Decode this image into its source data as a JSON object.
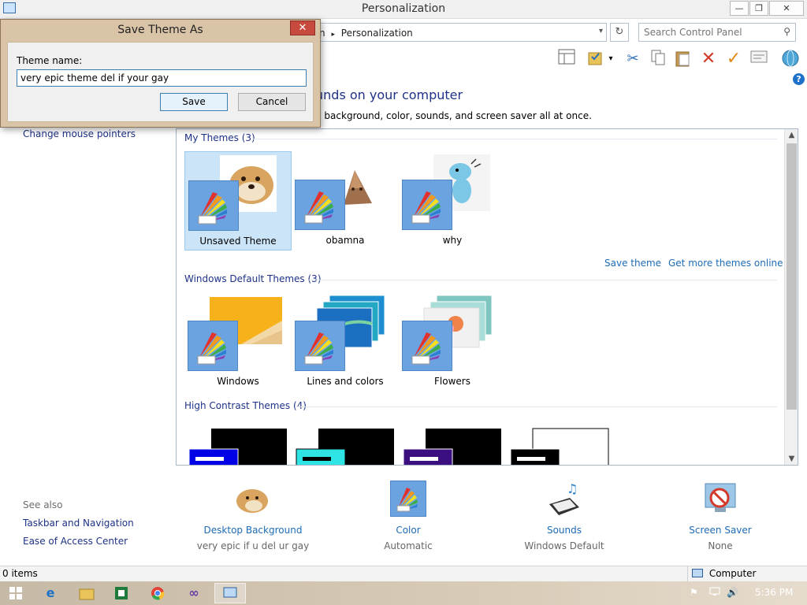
{
  "window": {
    "title": "Personalization",
    "minimize": "—",
    "restore": "❐",
    "close": "✕"
  },
  "address": {
    "breadcrumb_tail": "n",
    "separator": "▸",
    "current": "Personalization",
    "dropdown": "▾",
    "refresh": "↻",
    "search_placeholder": "Search Control Panel",
    "search_icon": "⚲"
  },
  "main": {
    "heading": "unds on your computer",
    "subtext": "p background, color, sounds, and screen saver all at once.",
    "help": "?"
  },
  "sidebar": {
    "items": [
      {
        "label": "Change mouse pointers"
      }
    ],
    "see_also_title": "See also",
    "see_also": [
      {
        "label": "Taskbar and Navigation"
      },
      {
        "label": "Ease of Access Center"
      }
    ]
  },
  "themes": {
    "my_themes_title": "My Themes (3)",
    "my_themes": [
      {
        "label": "Unsaved Theme"
      },
      {
        "label": "obamna"
      },
      {
        "label": "why"
      }
    ],
    "save_theme": "Save theme",
    "get_more": "Get more themes online",
    "defaults_title": "Windows Default Themes (3)",
    "defaults": [
      {
        "label": "Windows"
      },
      {
        "label": "Lines and colors"
      },
      {
        "label": "Flowers"
      }
    ],
    "high_contrast_title": "High Contrast Themes (4)"
  },
  "quick_settings": [
    {
      "label": "Desktop Background",
      "value": "very epic if u del ur gay"
    },
    {
      "label": "Color",
      "value": "Automatic"
    },
    {
      "label": "Sounds",
      "value": "Windows Default"
    },
    {
      "label": "Screen Saver",
      "value": "None"
    }
  ],
  "status": {
    "items": "0 items",
    "location": "Computer"
  },
  "taskbar": {
    "time": "5:36 PM"
  },
  "dialog": {
    "title": "Save Theme As",
    "close": "✕",
    "label": "Theme name:",
    "value": "very epic theme del if your gay",
    "save": "Save",
    "cancel": "Cancel"
  },
  "colors": {
    "link": "#1e6bb7",
    "heading": "#1e3287",
    "selection": "#cce4f7"
  }
}
